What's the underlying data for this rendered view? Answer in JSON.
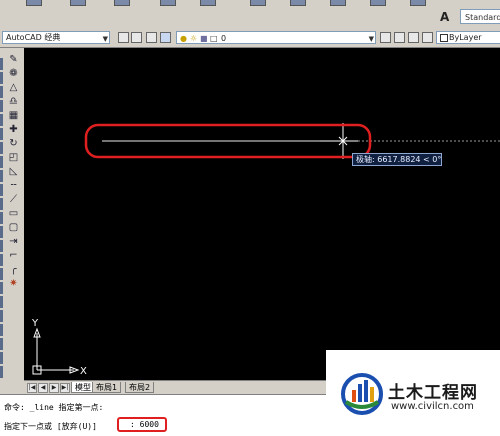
{
  "toolbar_top": {
    "text_style_icon": "text-style-icon",
    "text_style_value": "Standard"
  },
  "toolbar2": {
    "workspace_value": "AutoCAD 经典",
    "layer_value": "0",
    "color_value": "ByLayer"
  },
  "canvas": {
    "tooltip": "极轴: 6617.8824 < 0°",
    "ucs_y_label": "Y",
    "ucs_x_label": "X",
    "highlight_color": "#e02020"
  },
  "tabs": {
    "items": [
      "模型",
      "布局1",
      "布局2"
    ]
  },
  "command": {
    "line1": "命令: _line 指定第一点:",
    "line2_prompt": "指定下一点或 [放弃(U)]",
    "line2_input": ": 6000"
  },
  "watermark": {
    "title": "土木工程网",
    "url": "www.civilcn.com"
  }
}
